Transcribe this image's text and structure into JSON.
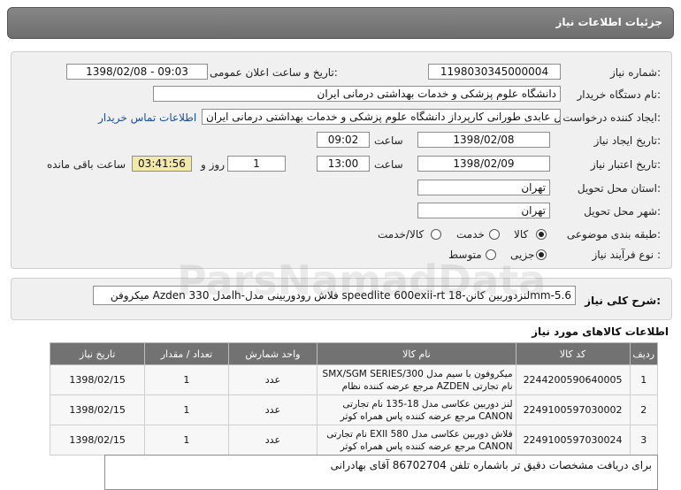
{
  "header": {
    "title": "جزئیات اطلاعات نیاز"
  },
  "form": {
    "need_number_label": "شماره نیاز:",
    "need_number": "1198030345000004",
    "announce_label": "تاریخ و ساعت اعلان عمومی:",
    "announce_value": "1398/02/08 - 09:03",
    "buyer_label": "نام دستگاه خریدار:",
    "buyer_value": "دانشگاه علوم پزشکی و خدمات بهداشتی درمانی ایران",
    "requester_label": "ایجاد کننده درخواست:",
    "requester_value": "عباس عابدی طورانی کارپرداز دانشگاه علوم پزشکی و خدمات بهداشتی درمانی ایران",
    "contact_link": "اطلاعات تماس خریدار",
    "created_label": "تاریخ ایجاد نیاز:",
    "created_date": "1398/02/08",
    "time_label": "ساعت",
    "created_time": "09:02",
    "validity_label": "تاریخ اعتبار نیاز:",
    "validity_date": "1398/02/09",
    "validity_time": "13:00",
    "days_value": "1",
    "days_label": "روز و",
    "remaining_value": "03:41:56",
    "remaining_label": "ساعت باقی مانده",
    "province_label": "استان محل تحویل:",
    "province_value": "تهران",
    "city_label": "شهر محل تحویل:",
    "city_value": "تهران",
    "category_label": "طبقه بندی موضوعی:",
    "category_options": [
      "کالا",
      "خدمت",
      "کالا/خدمت"
    ],
    "category_selected": "کالا",
    "process_label": "نوع فرآیند نیاز :",
    "process_options": [
      "جزیی",
      "متوسط"
    ],
    "process_selected": "جزیی"
  },
  "summary": {
    "label": "شرح کلی نیاز:",
    "value": "میکروفن Azden مدل 330lh-فلاش رودوربینی مدل speedlite 600exii-rt لنزدوربین کانن-18mm-5.6"
  },
  "items_section": {
    "title": "اطلاعات کالاهای مورد نیاز"
  },
  "table": {
    "headers": [
      "ردیف",
      "کد کالا",
      "نام کالا",
      "واحد شمارش",
      "تعداد / مقدار",
      "تاریخ نیاز"
    ],
    "rows": [
      {
        "row": "1",
        "code": "2244200590640005",
        "name": "میکروفون با سیم مدل SMX/SGM SERIES/300 نام تجارتی AZDEN مرجع عرضه کننده نظام",
        "unit": "عدد",
        "qty": "1",
        "date": "1398/02/15"
      },
      {
        "row": "2",
        "code": "2249100597030002",
        "name": "لنز دوربین عکاسی مدل 18-135 نام تجارتی CANON مرجع عرضه کننده پاس همراه کوثر",
        "unit": "عدد",
        "qty": "1",
        "date": "1398/02/15"
      },
      {
        "row": "3",
        "code": "2249100597030024",
        "name": "فلاش دوربین عکاسی مدل EXII 580 نام تجارتی CANON مرجع عرضه کننده پاس همراه کوثر",
        "unit": "عدد",
        "qty": "1",
        "date": "1398/02/15"
      }
    ]
  },
  "note": {
    "value": "برای دریافت مشخصات دقیق تر باشماره تلفن 86702704 آقای بهادرانی"
  },
  "watermark": {
    "text": "ParsNamadData"
  }
}
